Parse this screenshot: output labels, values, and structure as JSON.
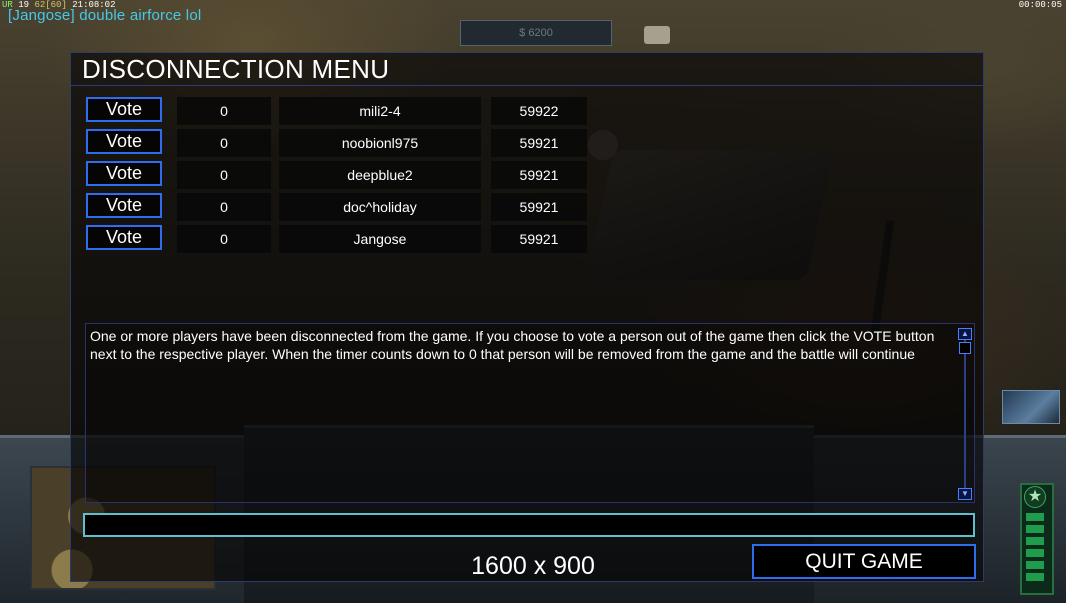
{
  "overlay": {
    "stats": {
      "ur": "UR",
      "value_a": "19",
      "value_b": "62",
      "fps": "[60]",
      "clock": "21:08:02"
    },
    "game_timer": "00:00:05",
    "chat_message": "[Jangose] double airforce lol"
  },
  "hud": {
    "money": "$ 6200"
  },
  "dialog": {
    "title": "DISCONNECTION MENU",
    "vote_label": "Vote",
    "players": [
      {
        "votes": "0",
        "name": "mili2-4",
        "timer": "59922"
      },
      {
        "votes": "0",
        "name": "noobionl975",
        "timer": "59921"
      },
      {
        "votes": "0",
        "name": "deepblue2",
        "timer": "59921"
      },
      {
        "votes": "0",
        "name": "doc^holiday",
        "timer": "59921"
      },
      {
        "votes": "0",
        "name": "Jangose",
        "timer": "59921"
      }
    ],
    "message": "One or more players have been disconnected from the game. If you choose to vote a person out of the game then click the VOTE button next to the respective player. When the timer counts down to 0 that person will be removed from the game and the battle will continue",
    "chat_input_value": "",
    "resolution": "1600 x 900",
    "quit_label": "QUIT GAME"
  }
}
